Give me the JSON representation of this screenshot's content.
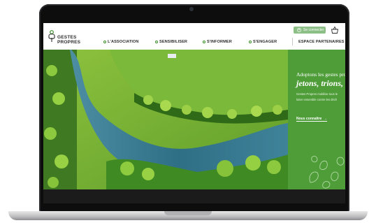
{
  "site": {
    "logo_line1": "GESTES",
    "logo_line2": "PROPRES"
  },
  "nav": {
    "items": [
      "L'ASSOCIATION",
      "SENSIBILISER",
      "S'INFORMER",
      "S'ENGAGER"
    ],
    "partners": "ESPACE PARTENAIRES"
  },
  "header": {
    "login_label": "Se connecter"
  },
  "hero_panel": {
    "title": "Adoptons les gestes pro",
    "subtitle": "jetons, trions, r",
    "body_line1": "Gestes Propres mobilise tous le",
    "body_line2": "lutter ensemble contre les déch",
    "link_label": "Nous connaître"
  },
  "colors": {
    "brand_green": "#4e9d39",
    "login_green": "#8cbf86",
    "accent_green": "#3c8c2c"
  },
  "icons": [
    "logo-icon",
    "user-icon",
    "basket-icon",
    "arrow-right-icon",
    "leaf-pattern"
  ]
}
